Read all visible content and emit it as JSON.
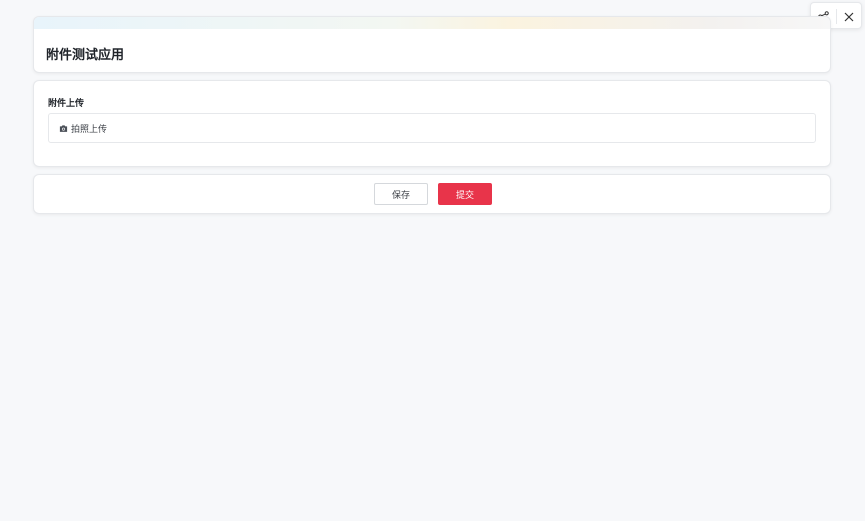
{
  "app": {
    "title": "附件测试应用"
  },
  "form": {
    "attachment_label": "附件上传",
    "upload": {
      "icon": "camera-icon",
      "text": "拍照上传"
    }
  },
  "actions": {
    "save_label": "保存",
    "submit_label": "提交"
  },
  "window_actions": {
    "share_icon": "share-icon",
    "close_icon": "close-icon"
  },
  "colors": {
    "accent": "#e8344a",
    "background": "#f7f8fa"
  }
}
